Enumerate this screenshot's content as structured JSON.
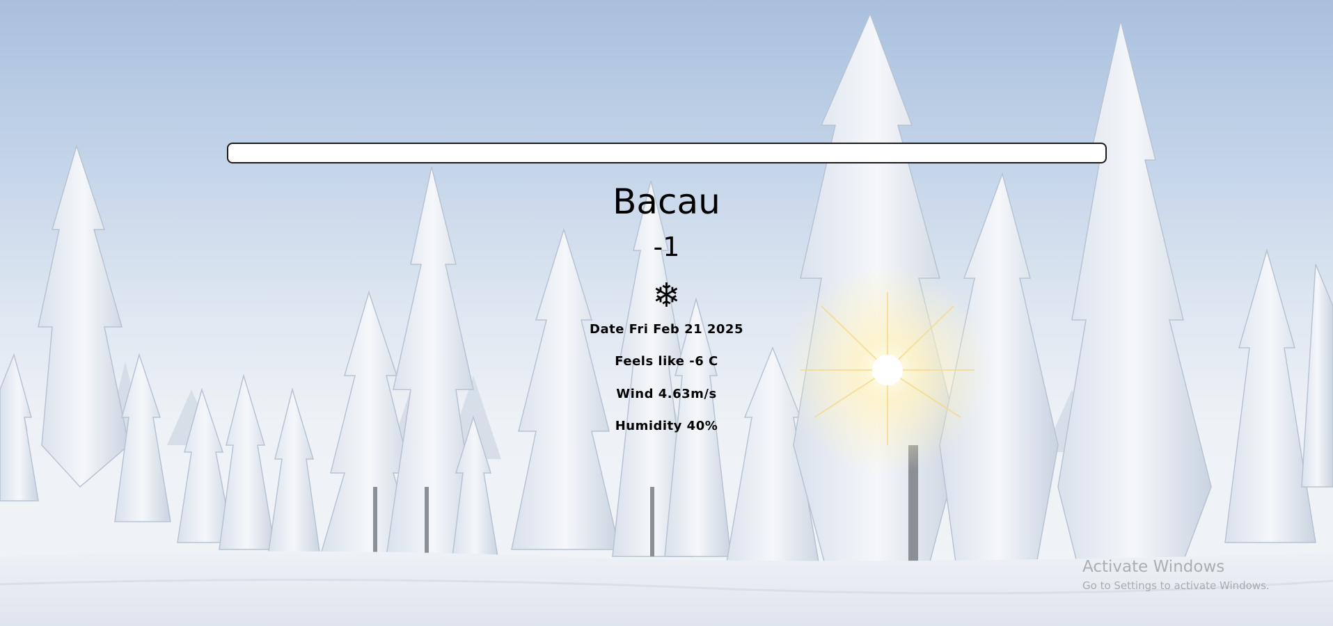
{
  "search": {
    "value": "",
    "placeholder": ""
  },
  "weather": {
    "city": "Bacau",
    "temperature": "-1",
    "icon": "snowflake-icon",
    "icon_glyph": "❄",
    "date": "Date Fri Feb 21 2025",
    "feels_like": "Feels like -6 C",
    "wind": "Wind 4.63m/s",
    "humidity": "Humidity 40%"
  },
  "watermark": {
    "title": "Activate Windows",
    "subtitle": "Go to Settings to activate Windows."
  },
  "colors": {
    "sky_top": "#a9c0dd",
    "snow": "#f2f4f7",
    "text": "#000000"
  }
}
